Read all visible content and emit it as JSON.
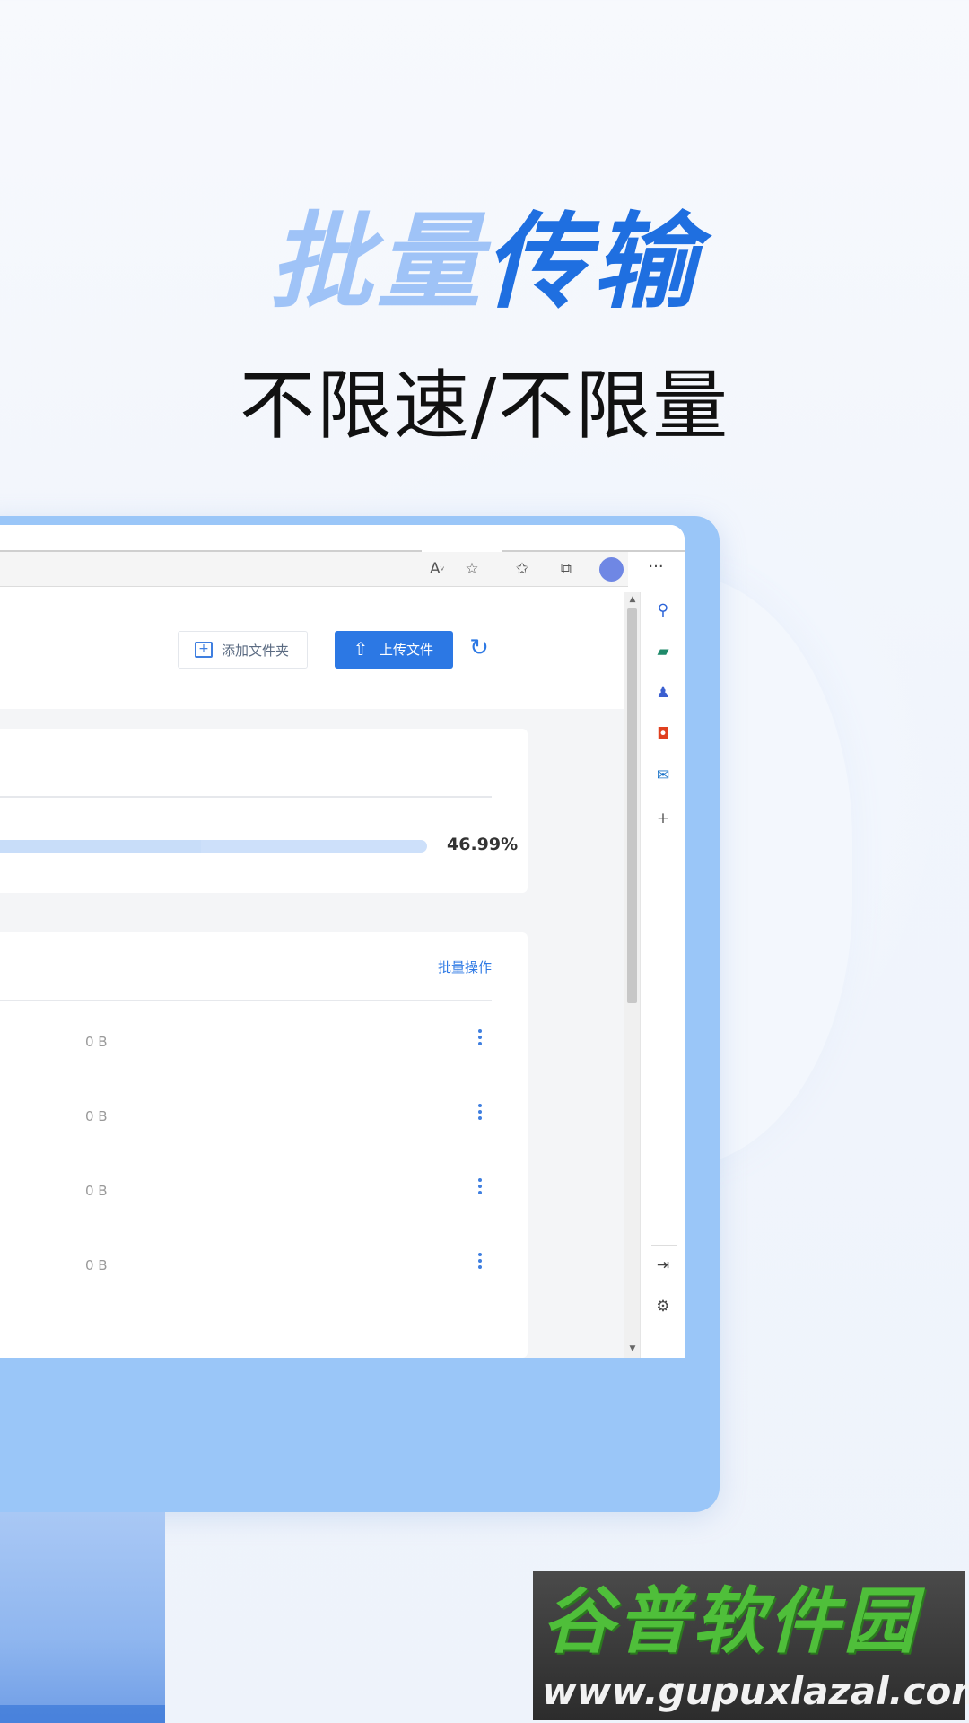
{
  "promo": {
    "title_light": "批量",
    "title_dark": "传输",
    "subtitle": "不限速/不限量"
  },
  "browser": {
    "toolbar_icons": [
      "read-aloud-icon",
      "add-favorite-icon",
      "favorites-icon",
      "collections-icon",
      "profile-avatar",
      "more-icon"
    ],
    "more_label": "···"
  },
  "header": {
    "add_folder_label": "添加文件夹",
    "upload_label": "上传文件"
  },
  "progress": {
    "percent_text": "46.99%",
    "value": 0.4699
  },
  "list": {
    "batch_label": "批量操作",
    "rows": [
      {
        "size": "0 B"
      },
      {
        "size": "0 B"
      },
      {
        "size": "0 B"
      },
      {
        "size": "0 B"
      }
    ]
  },
  "sidebar": {
    "icons": [
      "search-icon",
      "shopping-icon",
      "games-icon",
      "office-icon",
      "outlook-icon",
      "add-icon",
      "hide-sidebar-icon",
      "settings-icon"
    ]
  },
  "colors": {
    "accent": "#2c78e4",
    "title_light": "#9fc3f7",
    "title_dark": "#1f6fe0",
    "monitor_frame": "#9ac6f8"
  },
  "watermark": {
    "name": "谷普软件园",
    "url": "www.gupuxlazal.com"
  }
}
